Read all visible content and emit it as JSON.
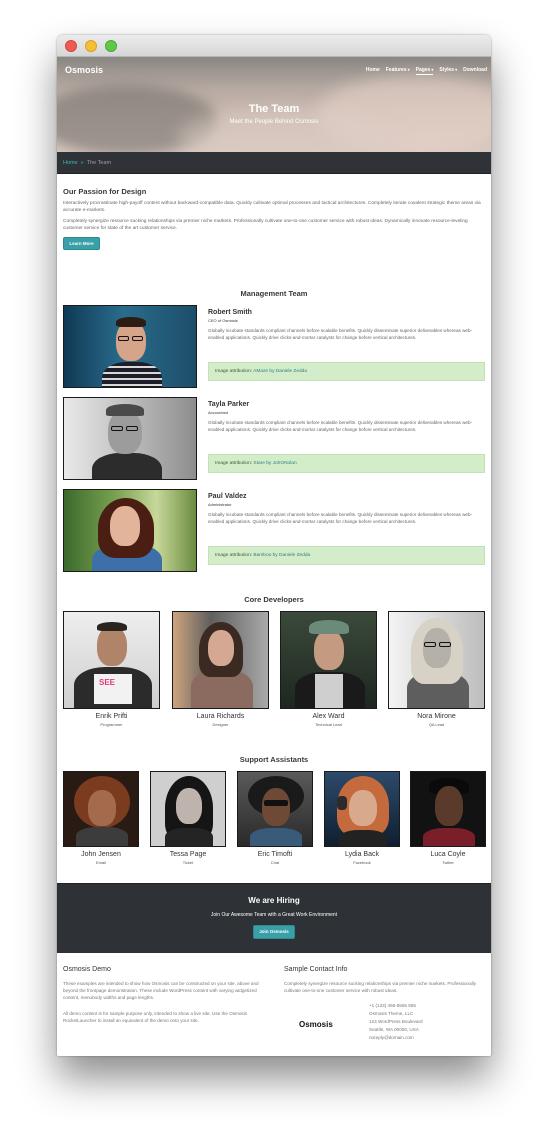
{
  "site": {
    "logo": "Osmosis",
    "nav": [
      {
        "label": "Home",
        "has_caret": false,
        "active": false
      },
      {
        "label": "Features",
        "has_caret": true,
        "active": false
      },
      {
        "label": "Pages",
        "has_caret": true,
        "active": true
      },
      {
        "label": "Styles",
        "has_caret": true,
        "active": false
      },
      {
        "label": "Download",
        "has_caret": false,
        "active": false
      }
    ]
  },
  "hero": {
    "title": "The Team",
    "subtitle": "Meet the People Behind Osmosis"
  },
  "breadcrumb": {
    "home": "Home",
    "separator": "»",
    "current": "The Team"
  },
  "passion": {
    "heading": "Our Passion for Design",
    "paragraph1": "Interactively procrastinate high-payoff content without backward-compatible data. Quickly cultivate optimal processes and tactical architectures. Completely iterate covalent strategic theme areas via accurate e-markets.",
    "paragraph2": "Completely synergize resource sucking relationships via premier niche markets. Professionally cultivate one-to-one customer service with robust ideas. Dynamically innovate resource-leveling customer service for state of the art customer service.",
    "button": "Learn More"
  },
  "management": {
    "heading": "Management Team",
    "attribution_prefix": "Image attribution:",
    "members": [
      {
        "name": "Robert Smith",
        "role": "CEO of Osmosis",
        "bio": "Globally incubate standards compliant channels before scalable benefits. Quickly disseminate superior deliverables whereas web-enabled applications. Quickly drive clicks-and-mortar catalysts for change before vertical architectures.",
        "attribution": "AMaze by Daniele Zedda"
      },
      {
        "name": "Tayla Parker",
        "role": "Accountant",
        "bio": "Globally incubate standards compliant channels before scalable benefits. Quickly disseminate superior deliverables whereas web-enabled applications. Quickly drive clicks-and-mortar catalysts for change before vertical architectures.",
        "attribution": "Stare by JohONolan"
      },
      {
        "name": "Paul Valdez",
        "role": "Administrator",
        "bio": "Globally incubate standards compliant channels before scalable benefits. Quickly disseminate superior deliverables whereas web-enabled applications. Quickly drive clicks-and-mortar catalysts for change before vertical architectures.",
        "attribution": "Bamboo by Daniele Zedda"
      }
    ]
  },
  "core_developers": {
    "heading": "Core Developers",
    "members": [
      {
        "name": "Enrik Prifti",
        "role": "Programmer"
      },
      {
        "name": "Laura Richards",
        "role": "Designer"
      },
      {
        "name": "Alex Ward",
        "role": "Technical Lead"
      },
      {
        "name": "Nora Mirone",
        "role": "QA Lead"
      }
    ]
  },
  "support": {
    "heading": "Support Assistants",
    "members": [
      {
        "name": "John Jensen",
        "role": "Email"
      },
      {
        "name": "Tessa Page",
        "role": "Ticket"
      },
      {
        "name": "Eric Timofti",
        "role": "Chat"
      },
      {
        "name": "Lydia Back",
        "role": "Facebook"
      },
      {
        "name": "Luca Coyle",
        "role": "Twitter"
      }
    ]
  },
  "hiring": {
    "title": "We are Hiring",
    "subtitle": "Join Our Awesome Team with a Great Work Environment",
    "button": "Join Osmosis"
  },
  "footer": {
    "demo_heading": "Osmosis Demo",
    "demo_text1": "These examples are intended to show how Osmosis can be constructed on your site, above and beyond the frontpage demonstration. These include WordPress content with varying widgetized content, menubody widths and page lengths.",
    "demo_text2": "All demo content is for sample purpose only, intended to show a live site. Use the Osmosis RocketLauncher to install an equivalent of the demo onto your site.",
    "contact_heading": "Sample Contact Info",
    "contact_text": "Completely synergize resource sucking relationships via premier niche markets. Professionally cultivate one-to-one customer service with robust ideas.",
    "logo": "Osmosis",
    "address": [
      "+1 (123) 456-5555 555",
      "Osmosis Theme, LLC",
      "123 WordPress Boulevard",
      "Seattle, WA 00000, USA",
      "noreply@domain.com"
    ]
  },
  "colors": {
    "accent": "#3aa0a8",
    "link": "#3eb5c4",
    "dark_bar": "#2f3236",
    "attribution_bg": "#d3ecc9"
  }
}
